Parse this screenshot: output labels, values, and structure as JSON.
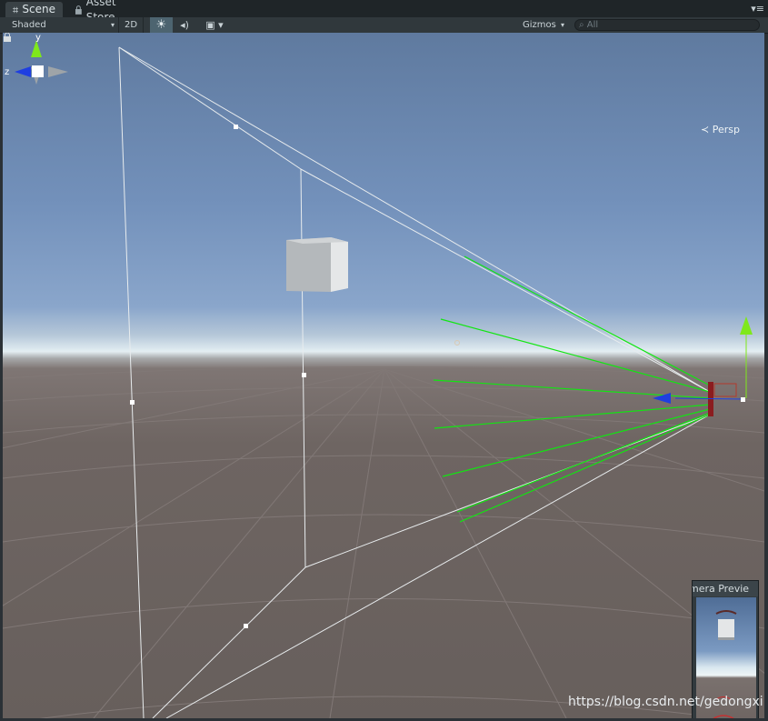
{
  "tabs": [
    {
      "label": "Scene",
      "icon": "grid-icon",
      "active": true
    },
    {
      "label": "Asset Store",
      "icon": "lock-icon",
      "active": false
    }
  ],
  "toolbar": {
    "shading_mode": "Shaded",
    "mode_2d_label": "2D",
    "gizmos_label": "Gizmos",
    "search_placeholder": "All"
  },
  "scene": {
    "projection_label": "Persp",
    "axis_y": "y",
    "axis_z": "z"
  },
  "camera_preview": {
    "title": "mera Previe"
  },
  "watermark": "https://blog.csdn.net/gedongxi",
  "colors": {
    "raycast_lines": "#11e611",
    "frustum_lines": "#e8ecee",
    "axis_x_red": "#d4272b",
    "axis_y_green": "#7fe81b",
    "axis_z_blue": "#1f3fe0"
  }
}
